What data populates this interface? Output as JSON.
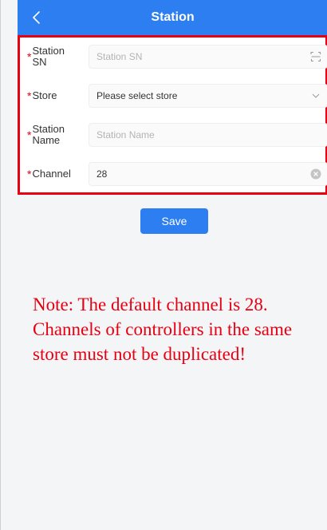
{
  "navbar": {
    "title": "Station",
    "back_icon": "chevron-left-icon"
  },
  "form": {
    "required_mark": "*",
    "station_sn": {
      "label_line1": "Station",
      "label_line2": "SN",
      "placeholder": "Station SN",
      "value": "",
      "icon": "scan-icon"
    },
    "store": {
      "label": "Store",
      "value": "Please select store",
      "icon": "chevron-down-icon"
    },
    "station_name": {
      "label_line1": "Station",
      "label_line2": "Name",
      "placeholder": "Station Name",
      "value": ""
    },
    "channel": {
      "label": "Channel",
      "value": "28",
      "icon": "clear-icon"
    }
  },
  "actions": {
    "save_label": "Save"
  },
  "note": "Note: The default channel is 28. Channels of controllers in the same store must not be duplicated!",
  "colors": {
    "primary": "#2d7ef1",
    "required": "#e60012",
    "annotation": "#e60012"
  }
}
